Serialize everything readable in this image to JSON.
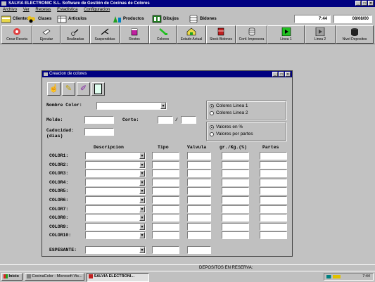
{
  "window": {
    "title": "SALVIA ELECTRONIC S.L.   Software de Gestión de Cocinas de Colores"
  },
  "menu": [
    "Archivo",
    "Ver",
    "Recetas",
    "Estadística",
    "Configuracion"
  ],
  "strip": {
    "items": [
      "Clientes",
      "Clases",
      "Articulos",
      "Productos",
      "Dibujos",
      "Bidones"
    ],
    "time": "7:44",
    "date": "08/08/00"
  },
  "toolbar": [
    "Crear Receta",
    "Ejecutar",
    "Realizadas",
    "Suspendidas",
    "Restos",
    "Colores",
    "Estado Actual",
    "Stock Bidones",
    "Conf. Impresora",
    "Linea 1",
    "Linea 2",
    "Nivel Depositos"
  ],
  "dialog": {
    "title": "Creacion de colores",
    "labels": {
      "nombre": "Nombre Color:",
      "molde": "Molde:",
      "corte": "Corte:",
      "slash": "/",
      "caducidad": "Caducidad:",
      "dias": "(dias)",
      "espesante": "ESPESANTE:"
    },
    "lineas": {
      "options": [
        "Colores Linea 1",
        "Colores Linea 2"
      ],
      "selected": 0
    },
    "valores": {
      "options": [
        "Valores en %",
        "Valores por partes"
      ],
      "selected": 0
    },
    "columns": [
      "Descripcion",
      "Tipo",
      "Valvula",
      "gr./Kg.(%)",
      "Partes"
    ],
    "rows": [
      "COLOR1:",
      "COLOR2:",
      "COLOR3:",
      "COLOR4:",
      "COLOR5:",
      "COLOR6:",
      "COLOR7:",
      "COLOR8:",
      "COLOR9:",
      "COLOR10:"
    ]
  },
  "statusbar": {
    "text": "DEPOSITOS EN RESERVA:"
  },
  "taskbar": {
    "start": "Inicio",
    "tasks": [
      "CocinaColor - Microsoft Vis...",
      "SALVIA ELECTRONI..."
    ],
    "clock": "7:44"
  },
  "colors": {
    "title_bar": "#000080",
    "face": "#c0c0c0"
  }
}
